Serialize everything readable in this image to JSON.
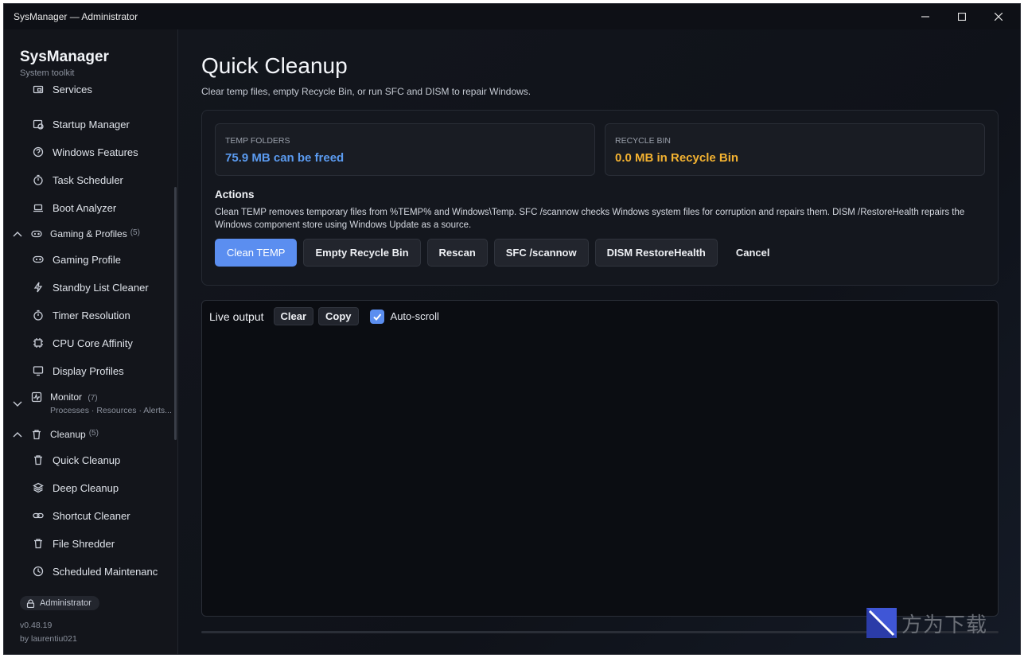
{
  "window": {
    "title": "SysManager — Administrator"
  },
  "brand": {
    "name": "SysManager",
    "subtitle": "System toolkit"
  },
  "sidebar": {
    "items_top": [
      {
        "label": "Services",
        "icon": "services-icon"
      },
      {
        "label": "Startup Manager",
        "icon": "startup-icon"
      },
      {
        "label": "Windows Features",
        "icon": "question-circle-icon"
      },
      {
        "label": "Task Scheduler",
        "icon": "timer-icon"
      },
      {
        "label": "Boot Analyzer",
        "icon": "laptop-icon"
      }
    ],
    "group_gaming": {
      "label": "Gaming & Profiles",
      "count": "(5)"
    },
    "items_gaming": [
      {
        "label": "Gaming Profile",
        "icon": "gamepad-icon"
      },
      {
        "label": "Standby List Cleaner",
        "icon": "lightning-icon"
      },
      {
        "label": "Timer Resolution",
        "icon": "timer-icon"
      },
      {
        "label": "CPU Core Affinity",
        "icon": "cpu-icon"
      },
      {
        "label": "Display Profiles",
        "icon": "monitor-icon"
      }
    ],
    "group_monitor": {
      "label": "Monitor",
      "count": "(7)",
      "desc": "Processes · Resources · Alerts..."
    },
    "group_cleanup": {
      "label": "Cleanup",
      "count": "(5)"
    },
    "items_cleanup": [
      {
        "label": "Quick Cleanup",
        "icon": "trash-icon"
      },
      {
        "label": "Deep Cleanup",
        "icon": "layers-icon"
      },
      {
        "label": "Shortcut Cleaner",
        "icon": "link-icon"
      },
      {
        "label": "File Shredder",
        "icon": "trash-icon"
      },
      {
        "label": "Scheduled Maintenanc",
        "icon": "clock-icon"
      }
    ],
    "admin_badge": "Administrator",
    "version": "v0.48.19",
    "author": "by laurentiu021"
  },
  "main": {
    "title": "Quick Cleanup",
    "subtitle": "Clear temp files, empty Recycle Bin, or run SFC and DISM to repair Windows.",
    "temp": {
      "label": "TEMP FOLDERS",
      "value": "75.9 MB can be freed",
      "color": "#5b9bf0"
    },
    "recycle": {
      "label": "RECYCLE BIN",
      "value": "0.0 MB in Recycle Bin",
      "color": "#f3b231"
    },
    "actions_heading": "Actions",
    "actions_desc": "Clean TEMP removes temporary files from %TEMP% and Windows\\Temp. SFC /scannow checks Windows system files for corruption and repairs them. DISM /RestoreHealth repairs the Windows component store using Windows Update as a source.",
    "buttons": {
      "clean_temp": "Clean TEMP",
      "empty_recycle": "Empty Recycle Bin",
      "rescan": "Rescan",
      "sfc": "SFC /scannow",
      "dism": "DISM RestoreHealth",
      "cancel": "Cancel"
    },
    "output": {
      "title": "Live output",
      "clear": "Clear",
      "copy": "Copy",
      "autoscroll_label": "Auto-scroll",
      "autoscroll_checked": true
    },
    "progress": 0
  },
  "watermark": {
    "text": "方为下载"
  },
  "colors": {
    "accent": "#5b8ef0",
    "background": "#0f1117"
  }
}
